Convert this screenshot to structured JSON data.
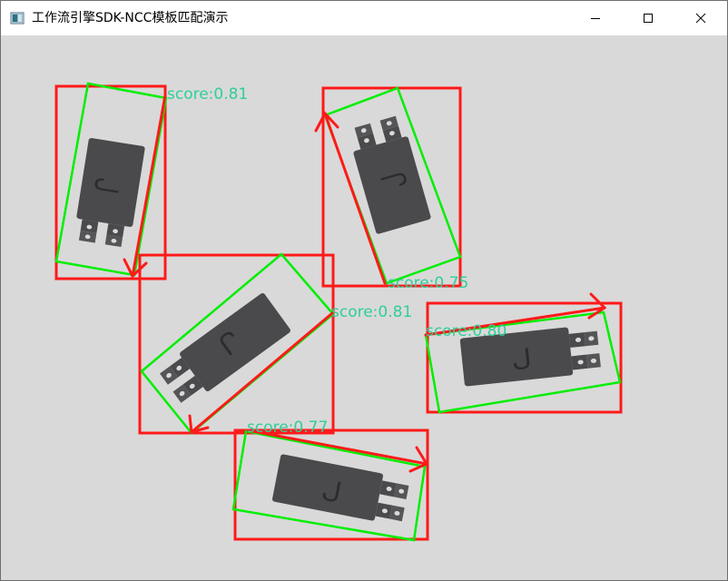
{
  "window": {
    "title": "工作流引擎SDK-NCC模板匹配演示",
    "app_icon": "image-window-icon",
    "controls": {
      "minimize_icon": "minimize-icon",
      "maximize_icon": "maximize-icon",
      "close_icon": "close-icon"
    }
  },
  "colors": {
    "background": "#d9d9d9",
    "part_body": "#4a4a4d",
    "match_outline": "#00ee00",
    "bounding_box": "#ff1a1a",
    "score_text": "#2ecf9a"
  },
  "matches": [
    {
      "score": "score:0.81"
    },
    {
      "score": "score:0.75"
    },
    {
      "score": "score:0.81"
    },
    {
      "score": "score:0.80"
    },
    {
      "score": "score:0.77"
    }
  ]
}
